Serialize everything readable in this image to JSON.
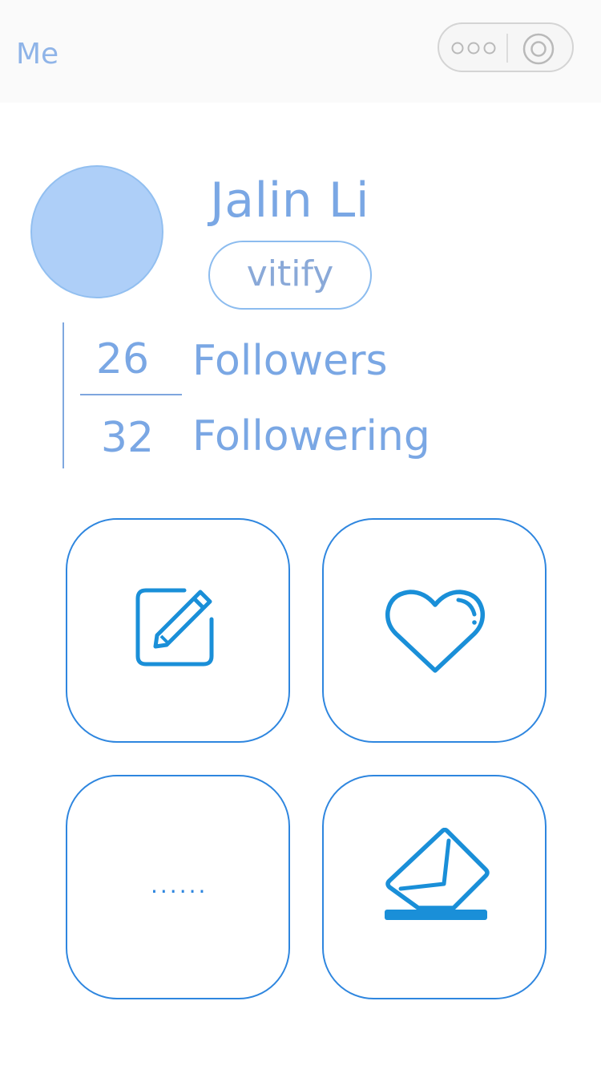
{
  "navbar": {
    "title": "Me",
    "more_icon": "more-dots-icon",
    "close_icon": "target-circle-icon"
  },
  "profile": {
    "name": "Jalin Li",
    "tag": "vitify"
  },
  "stats": {
    "followers_count": "26",
    "followers_label": "Followers",
    "following_count": "32",
    "following_label": "Followering"
  },
  "tiles": {
    "edit_icon": "edit-pencil-icon",
    "like_icon": "heart-icon",
    "more_text": "......",
    "mail_icon": "envelope-drop-icon"
  },
  "colors": {
    "accent": "#2e86df",
    "text_blue": "#7aa7e4",
    "avatar_fill": "#aecff8",
    "icon_blue": "#1a8fd8"
  }
}
